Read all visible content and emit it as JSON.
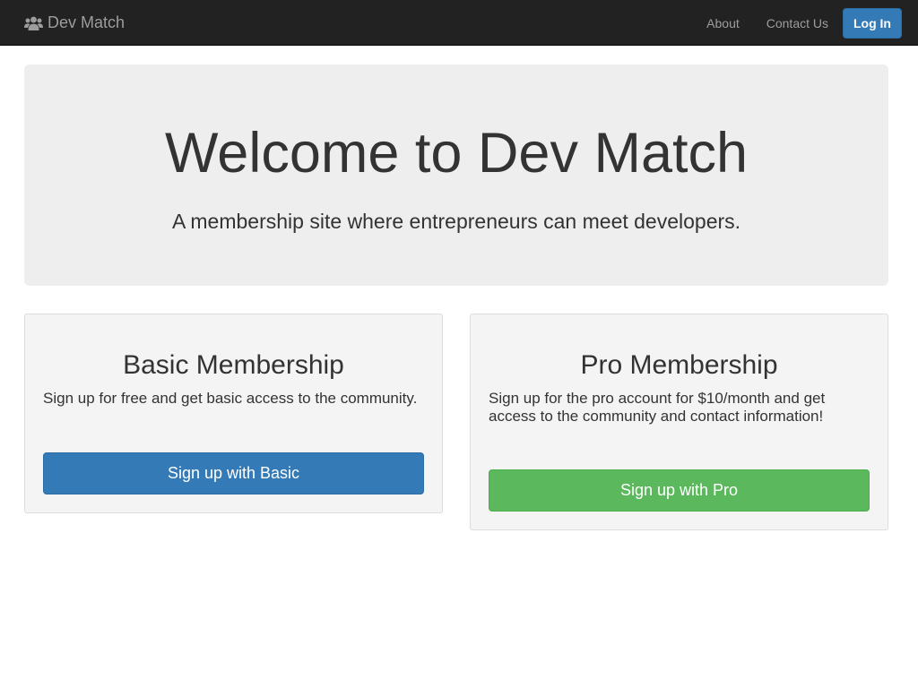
{
  "navbar": {
    "brand_icon": "users-icon",
    "brand_label": "Dev Match",
    "links": [
      "About",
      "Contact Us"
    ],
    "login_label": "Log In"
  },
  "hero": {
    "title": "Welcome to Dev Match",
    "subtitle": "A membership site where entrepreneurs can meet developers."
  },
  "plans": {
    "basic": {
      "title": "Basic Membership",
      "description": "Sign up for free and get basic access to the community.",
      "button_label": "Sign up with Basic"
    },
    "pro": {
      "title": "Pro Membership",
      "description": "Sign up for the pro account for $10/month and get access to the community and contact information!",
      "button_label": "Sign up with Pro"
    }
  },
  "colors": {
    "navbar_bg": "#222222",
    "primary": "#337ab7",
    "success": "#5cb85c",
    "jumbotron_bg": "#eeeeee",
    "panel_bg": "#f4f4f4"
  }
}
